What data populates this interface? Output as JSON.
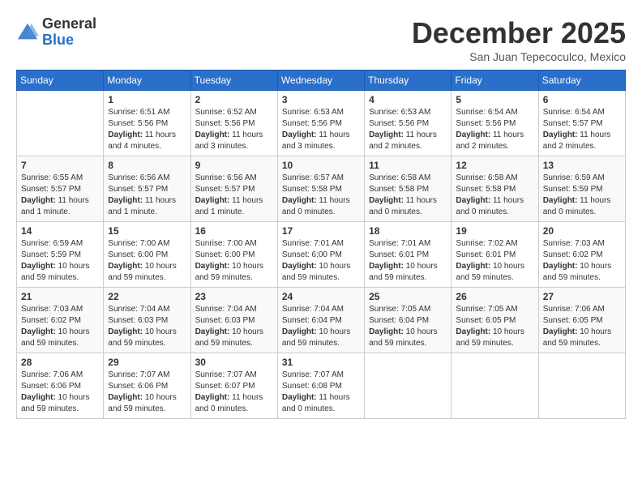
{
  "header": {
    "logo_general": "General",
    "logo_blue": "Blue",
    "month_title": "December 2025",
    "location": "San Juan Tepecoculco, Mexico"
  },
  "weekdays": [
    "Sunday",
    "Monday",
    "Tuesday",
    "Wednesday",
    "Thursday",
    "Friday",
    "Saturday"
  ],
  "weeks": [
    [
      {
        "day": "",
        "sunrise": "",
        "sunset": "",
        "daylight": ""
      },
      {
        "day": "1",
        "sunrise": "Sunrise: 6:51 AM",
        "sunset": "Sunset: 5:56 PM",
        "daylight": "Daylight: 11 hours and 4 minutes."
      },
      {
        "day": "2",
        "sunrise": "Sunrise: 6:52 AM",
        "sunset": "Sunset: 5:56 PM",
        "daylight": "Daylight: 11 hours and 3 minutes."
      },
      {
        "day": "3",
        "sunrise": "Sunrise: 6:53 AM",
        "sunset": "Sunset: 5:56 PM",
        "daylight": "Daylight: 11 hours and 3 minutes."
      },
      {
        "day": "4",
        "sunrise": "Sunrise: 6:53 AM",
        "sunset": "Sunset: 5:56 PM",
        "daylight": "Daylight: 11 hours and 2 minutes."
      },
      {
        "day": "5",
        "sunrise": "Sunrise: 6:54 AM",
        "sunset": "Sunset: 5:56 PM",
        "daylight": "Daylight: 11 hours and 2 minutes."
      },
      {
        "day": "6",
        "sunrise": "Sunrise: 6:54 AM",
        "sunset": "Sunset: 5:57 PM",
        "daylight": "Daylight: 11 hours and 2 minutes."
      }
    ],
    [
      {
        "day": "7",
        "sunrise": "Sunrise: 6:55 AM",
        "sunset": "Sunset: 5:57 PM",
        "daylight": "Daylight: 11 hours and 1 minute."
      },
      {
        "day": "8",
        "sunrise": "Sunrise: 6:56 AM",
        "sunset": "Sunset: 5:57 PM",
        "daylight": "Daylight: 11 hours and 1 minute."
      },
      {
        "day": "9",
        "sunrise": "Sunrise: 6:56 AM",
        "sunset": "Sunset: 5:57 PM",
        "daylight": "Daylight: 11 hours and 1 minute."
      },
      {
        "day": "10",
        "sunrise": "Sunrise: 6:57 AM",
        "sunset": "Sunset: 5:58 PM",
        "daylight": "Daylight: 11 hours and 0 minutes."
      },
      {
        "day": "11",
        "sunrise": "Sunrise: 6:58 AM",
        "sunset": "Sunset: 5:58 PM",
        "daylight": "Daylight: 11 hours and 0 minutes."
      },
      {
        "day": "12",
        "sunrise": "Sunrise: 6:58 AM",
        "sunset": "Sunset: 5:58 PM",
        "daylight": "Daylight: 11 hours and 0 minutes."
      },
      {
        "day": "13",
        "sunrise": "Sunrise: 6:59 AM",
        "sunset": "Sunset: 5:59 PM",
        "daylight": "Daylight: 11 hours and 0 minutes."
      }
    ],
    [
      {
        "day": "14",
        "sunrise": "Sunrise: 6:59 AM",
        "sunset": "Sunset: 5:59 PM",
        "daylight": "Daylight: 10 hours and 59 minutes."
      },
      {
        "day": "15",
        "sunrise": "Sunrise: 7:00 AM",
        "sunset": "Sunset: 6:00 PM",
        "daylight": "Daylight: 10 hours and 59 minutes."
      },
      {
        "day": "16",
        "sunrise": "Sunrise: 7:00 AM",
        "sunset": "Sunset: 6:00 PM",
        "daylight": "Daylight: 10 hours and 59 minutes."
      },
      {
        "day": "17",
        "sunrise": "Sunrise: 7:01 AM",
        "sunset": "Sunset: 6:00 PM",
        "daylight": "Daylight: 10 hours and 59 minutes."
      },
      {
        "day": "18",
        "sunrise": "Sunrise: 7:01 AM",
        "sunset": "Sunset: 6:01 PM",
        "daylight": "Daylight: 10 hours and 59 minutes."
      },
      {
        "day": "19",
        "sunrise": "Sunrise: 7:02 AM",
        "sunset": "Sunset: 6:01 PM",
        "daylight": "Daylight: 10 hours and 59 minutes."
      },
      {
        "day": "20",
        "sunrise": "Sunrise: 7:03 AM",
        "sunset": "Sunset: 6:02 PM",
        "daylight": "Daylight: 10 hours and 59 minutes."
      }
    ],
    [
      {
        "day": "21",
        "sunrise": "Sunrise: 7:03 AM",
        "sunset": "Sunset: 6:02 PM",
        "daylight": "Daylight: 10 hours and 59 minutes."
      },
      {
        "day": "22",
        "sunrise": "Sunrise: 7:04 AM",
        "sunset": "Sunset: 6:03 PM",
        "daylight": "Daylight: 10 hours and 59 minutes."
      },
      {
        "day": "23",
        "sunrise": "Sunrise: 7:04 AM",
        "sunset": "Sunset: 6:03 PM",
        "daylight": "Daylight: 10 hours and 59 minutes."
      },
      {
        "day": "24",
        "sunrise": "Sunrise: 7:04 AM",
        "sunset": "Sunset: 6:04 PM",
        "daylight": "Daylight: 10 hours and 59 minutes."
      },
      {
        "day": "25",
        "sunrise": "Sunrise: 7:05 AM",
        "sunset": "Sunset: 6:04 PM",
        "daylight": "Daylight: 10 hours and 59 minutes."
      },
      {
        "day": "26",
        "sunrise": "Sunrise: 7:05 AM",
        "sunset": "Sunset: 6:05 PM",
        "daylight": "Daylight: 10 hours and 59 minutes."
      },
      {
        "day": "27",
        "sunrise": "Sunrise: 7:06 AM",
        "sunset": "Sunset: 6:05 PM",
        "daylight": "Daylight: 10 hours and 59 minutes."
      }
    ],
    [
      {
        "day": "28",
        "sunrise": "Sunrise: 7:06 AM",
        "sunset": "Sunset: 6:06 PM",
        "daylight": "Daylight: 10 hours and 59 minutes."
      },
      {
        "day": "29",
        "sunrise": "Sunrise: 7:07 AM",
        "sunset": "Sunset: 6:06 PM",
        "daylight": "Daylight: 10 hours and 59 minutes."
      },
      {
        "day": "30",
        "sunrise": "Sunrise: 7:07 AM",
        "sunset": "Sunset: 6:07 PM",
        "daylight": "Daylight: 11 hours and 0 minutes."
      },
      {
        "day": "31",
        "sunrise": "Sunrise: 7:07 AM",
        "sunset": "Sunset: 6:08 PM",
        "daylight": "Daylight: 11 hours and 0 minutes."
      },
      {
        "day": "",
        "sunrise": "",
        "sunset": "",
        "daylight": ""
      },
      {
        "day": "",
        "sunrise": "",
        "sunset": "",
        "daylight": ""
      },
      {
        "day": "",
        "sunrise": "",
        "sunset": "",
        "daylight": ""
      }
    ]
  ]
}
